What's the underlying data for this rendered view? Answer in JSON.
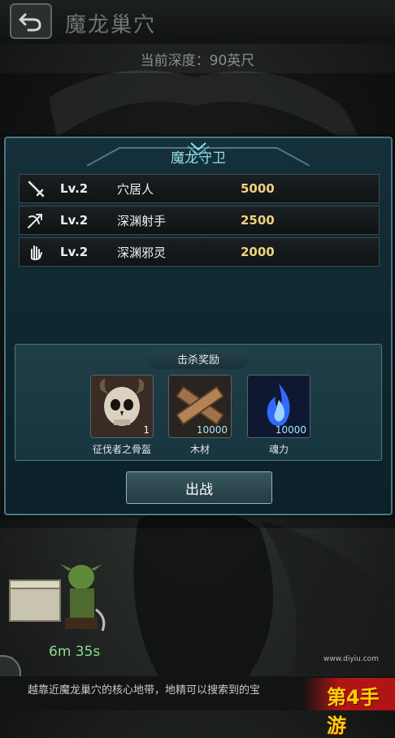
{
  "header": {
    "title": "魔龙巢穴",
    "depth": "当前深度：90英尺"
  },
  "panel": {
    "title": "魔龙守卫",
    "enemies": [
      {
        "icon": "sword-icon",
        "level": "Lv.2",
        "name": "穴居人",
        "power": "5000"
      },
      {
        "icon": "crossbow-icon",
        "level": "Lv.2",
        "name": "深渊射手",
        "power": "2500"
      },
      {
        "icon": "ghost-hand-icon",
        "level": "Lv.2",
        "name": "深渊邪灵",
        "power": "2000"
      }
    ],
    "reward_title": "击杀奖励",
    "rewards": [
      {
        "icon": "skull-helmet-icon",
        "count": "1",
        "name": "征伐者之骨盔"
      },
      {
        "icon": "wood-planks-icon",
        "count": "10000",
        "name": "木材"
      },
      {
        "icon": "blue-flame-icon",
        "count": "10000",
        "name": "魂力"
      }
    ],
    "fight_label": "出战"
  },
  "timer": "6m 35s",
  "bottom_text": "越靠近魔龙巢穴的核心地带，地精可以搜索到的宝",
  "watermark": {
    "logo": "第4手游",
    "url": "www.diyiu.com"
  },
  "colors": {
    "accent": "#8fe0e6",
    "power": "#f2d27a",
    "timer": "#8bdc8b",
    "panel_border": "#4e7784"
  }
}
